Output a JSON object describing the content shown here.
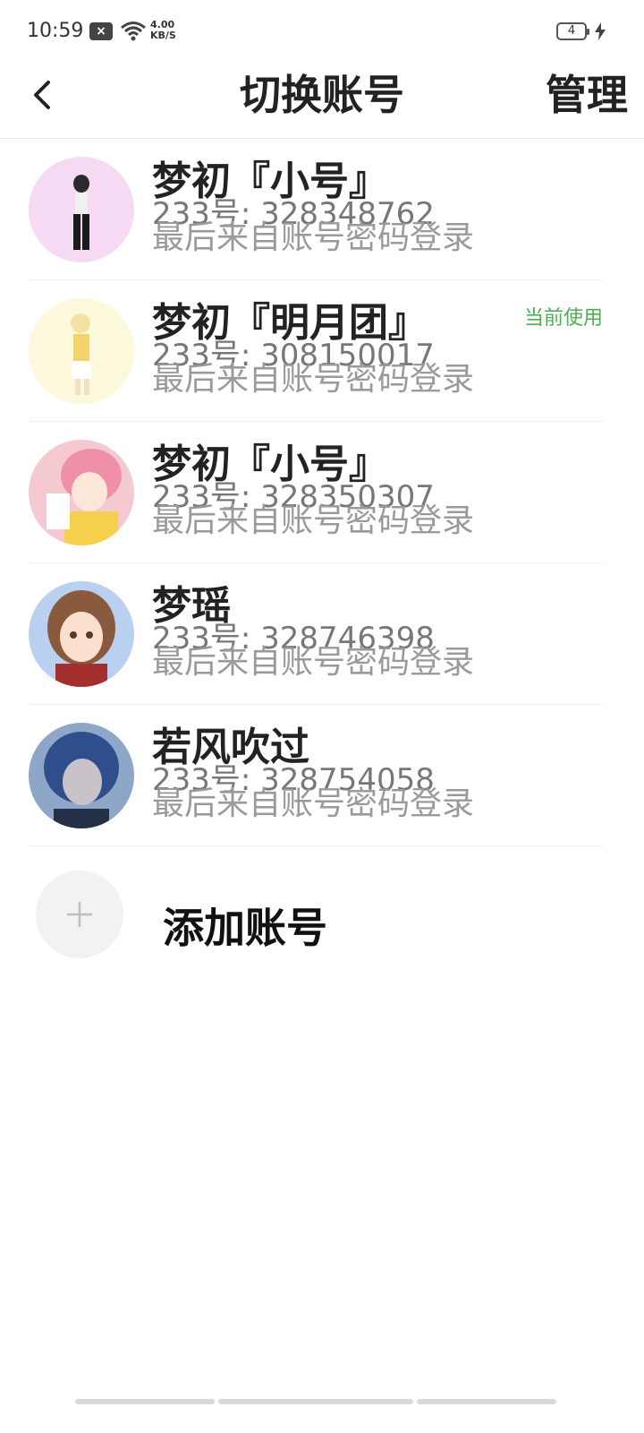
{
  "status_bar": {
    "time": "10:59",
    "notification_icon": "close-box-icon",
    "net_speed": "4.00",
    "net_unit": "KB/S",
    "battery_level": "4"
  },
  "header": {
    "back_icon": "chevron-left-icon",
    "title": "切换账号",
    "manage_label": "管理"
  },
  "accounts": [
    {
      "name": "梦初『小号』",
      "id_line": "233号: 328348762",
      "login_line": "最后来自账号密码登录",
      "badge": "",
      "avatar_color": "#f6d9f3"
    },
    {
      "name": "梦初『明月团』",
      "id_line": "233号: 308150017",
      "login_line": "最后来自账号密码登录",
      "badge": "当前使用",
      "avatar_color": "#fdf9dc"
    },
    {
      "name": "梦初『小号』",
      "id_line": "233号: 328350307",
      "login_line": "最后来自账号密码登录",
      "badge": "",
      "avatar_color": "#f4c9cf"
    },
    {
      "name": "梦瑶",
      "id_line": "233号: 328746398",
      "login_line": "最后来自账号密码登录",
      "badge": "",
      "avatar_color": "#b9d0f0"
    },
    {
      "name": "若风吹过",
      "id_line": "233号: 328754058",
      "login_line": "最后来自账号密码登录",
      "badge": "",
      "avatar_color": "#8ea6c8"
    }
  ],
  "add_account": {
    "icon": "plus-icon",
    "label": "添加账号"
  },
  "colors": {
    "accent_green": "#4caf50",
    "divider": "#eeeeee"
  }
}
